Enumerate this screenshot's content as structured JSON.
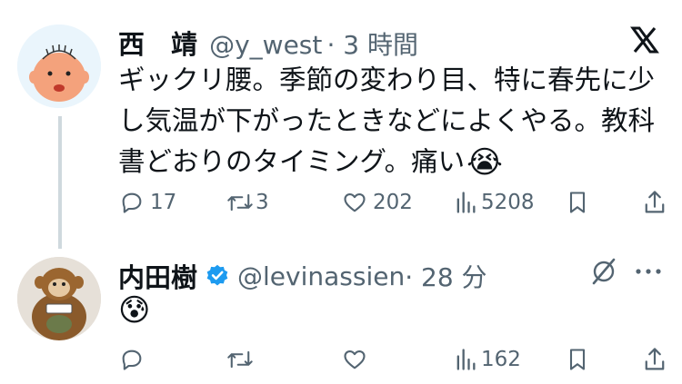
{
  "tweet1": {
    "display_name": "西　靖",
    "handle": "@y_west",
    "time": "· 3 時間",
    "text_lines": [
      "ギックリ腰。季節の変わり目、特に春先に少",
      "し気温が下がったときなどによくやる。教科",
      "書どおりのタイミング。痛い"
    ],
    "emoji": "😭",
    "reply_count": "17",
    "retweet_count": "3",
    "like_count": "202",
    "view_count": "5208"
  },
  "tweet2": {
    "display_name": "内田樹",
    "handle": "@levinassien",
    "time": "· 28 分",
    "emoji": "😰",
    "reply_count": "",
    "retweet_count": "",
    "like_count": "",
    "view_count": "162"
  },
  "icons": {
    "x_logo": "x-logo-icon",
    "verified": "verified-badge-icon",
    "grok": "grok-icon",
    "more": "more-icon",
    "reply": "reply-icon",
    "retweet": "retweet-icon",
    "like": "like-icon",
    "views": "views-icon",
    "bookmark": "bookmark-icon",
    "share": "share-icon"
  },
  "colors": {
    "text": "#0f1419",
    "muted": "#536471",
    "verified": "#1d9bf0",
    "thread_line": "#cfd9de"
  }
}
